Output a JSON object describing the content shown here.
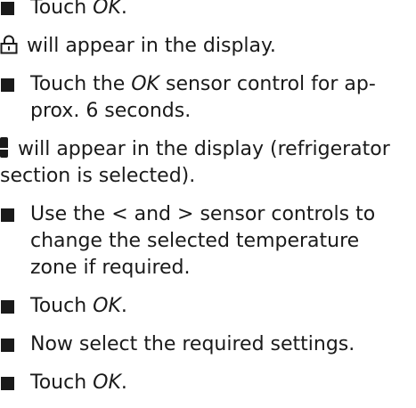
{
  "content": {
    "step1": {
      "prefix": "Touch ",
      "em": "OK",
      "suffix": "."
    },
    "result1": {
      "icon": "lock-icon",
      "text": " will appear in the display."
    },
    "step2": {
      "line1": "Touch the ",
      "em": "OK",
      "rest1": " sensor control for ap-",
      "line2": "prox. 6 seconds."
    },
    "result2": {
      "icon": "fridge-icon",
      "line1": " will appear in the display (refrigerator",
      "line2": "section is selected)."
    },
    "step3": {
      "text1": "Use the ",
      "lt": "<",
      "and": " and ",
      "gt": ">",
      "text2": " sensor controls to",
      "line2": "change the selected temperature",
      "line3": "zone if required."
    },
    "step4": {
      "prefix": "Touch ",
      "em": "OK",
      "suffix": "."
    },
    "step5": {
      "text": "Now select the required settings."
    },
    "step6": {
      "prefix": "Touch ",
      "em": "OK",
      "suffix": "."
    }
  }
}
